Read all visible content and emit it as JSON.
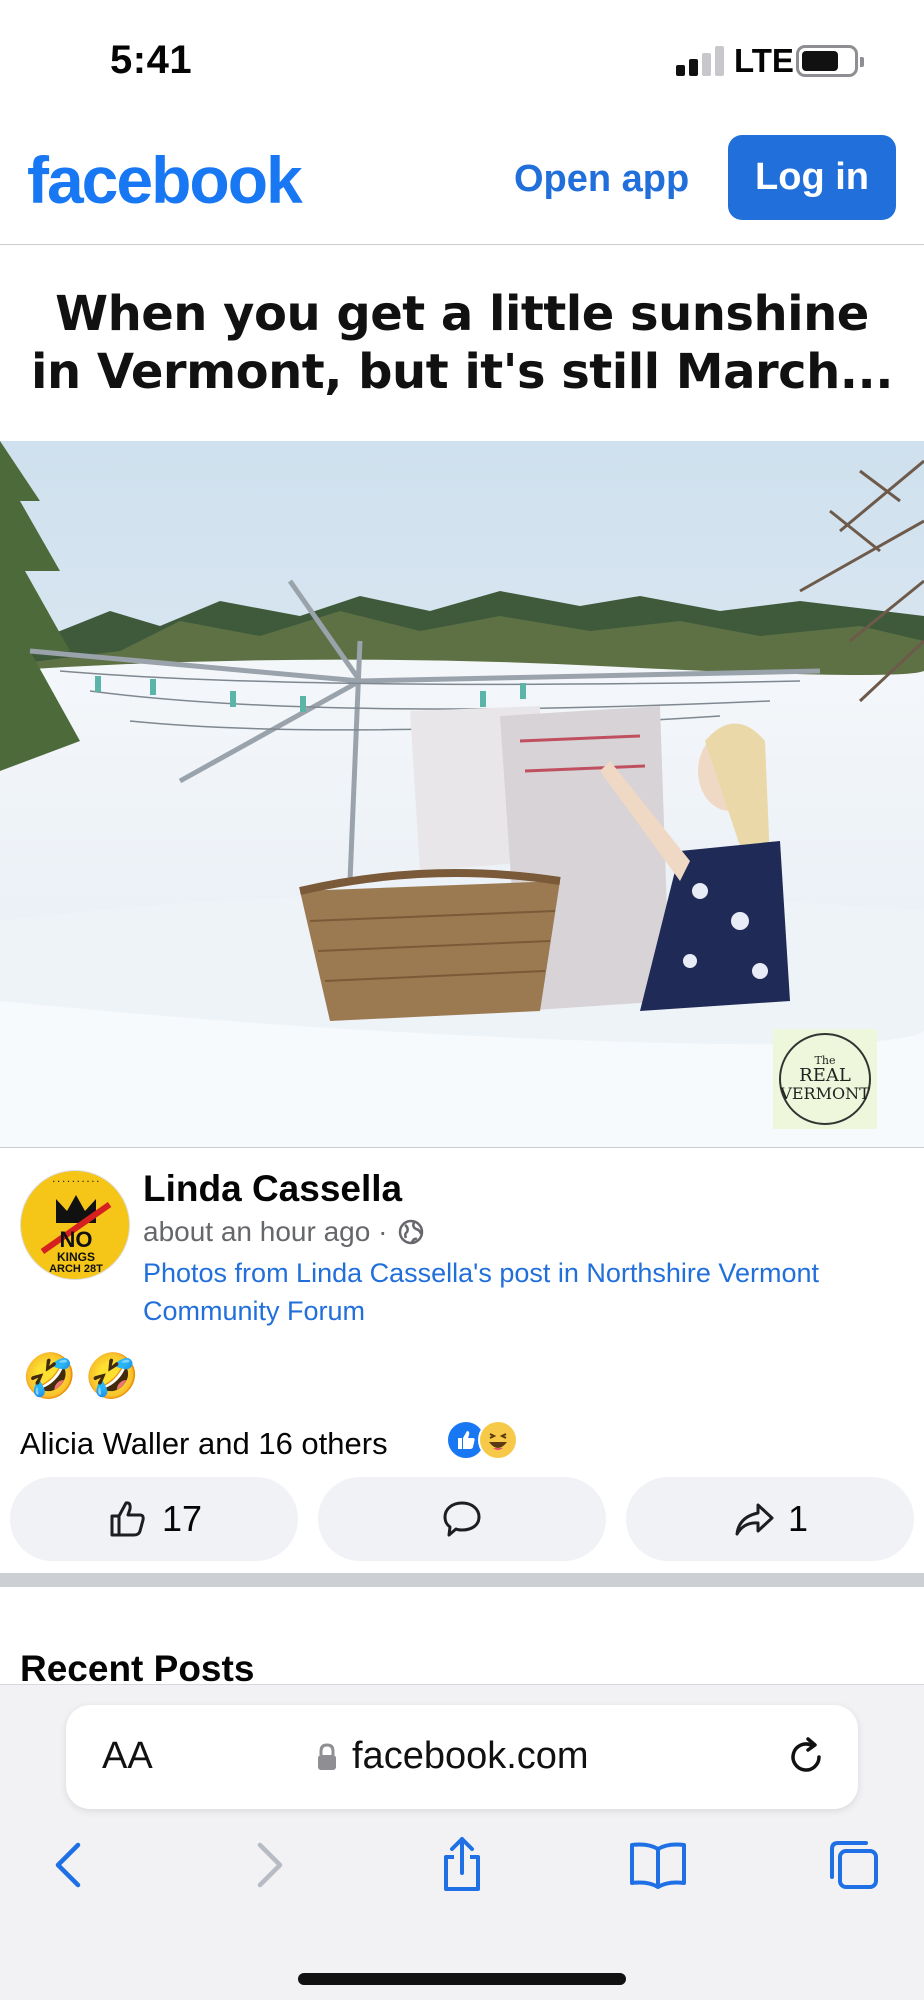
{
  "status_bar": {
    "time": "5:41",
    "network": "LTE"
  },
  "header": {
    "logo": "facebook",
    "open_app_label": "Open app",
    "login_label": "Log in"
  },
  "post": {
    "image": {
      "caption_line1": "When you get a little sunshine",
      "caption_line2": "in Vermont, but it's still March...",
      "watermark_small": "The",
      "watermark_line1": "REAL",
      "watermark_line2": "VERMONT"
    },
    "author": {
      "name": "Linda Cassella",
      "time": "about an hour ago ·",
      "source": "Photos from Linda Cassella's post in Northshire Vermont Community Forum",
      "avatar_text": {
        "no": "NO",
        "kings": "KINGS",
        "date": "ARCH 28T"
      }
    },
    "text": "🤣🤣",
    "reactions": {
      "summary": "Alicia Waller and 16 others",
      "icons": [
        "like-icon",
        "haha-icon"
      ]
    },
    "actions": {
      "like_count": "17",
      "share_count": "1"
    }
  },
  "recent_posts_title": "Recent Posts",
  "safari": {
    "text_size_label": "AA",
    "url": "facebook.com"
  },
  "colors": {
    "brand": "#1877f2",
    "button_blue": "#216fdb",
    "link": "#216fdb",
    "secondary_text": "#65676b"
  }
}
